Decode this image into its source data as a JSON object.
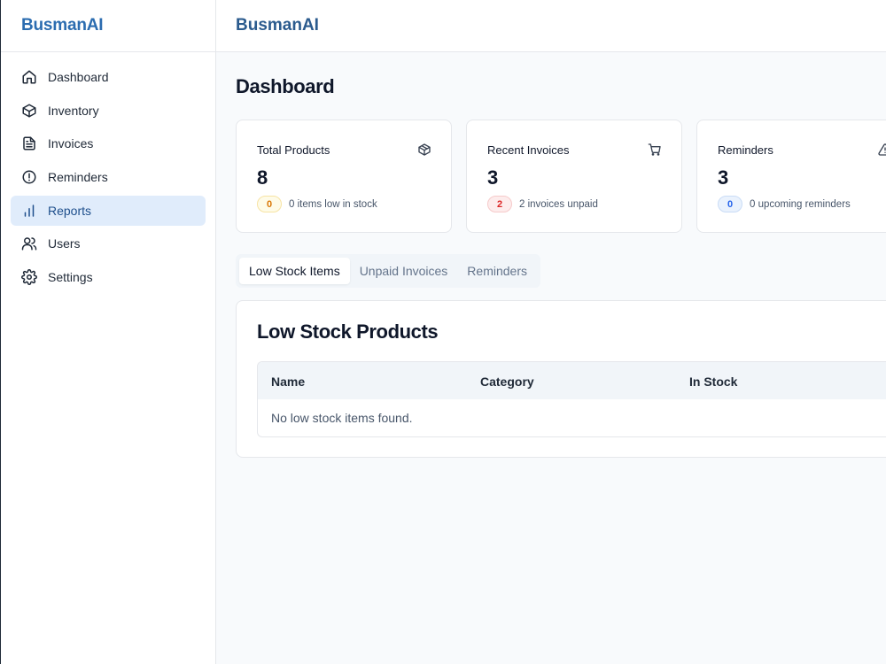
{
  "brand": "BusmanAI",
  "header": {
    "title": "BusmanAI"
  },
  "sidebar": {
    "items": [
      {
        "label": "Dashboard",
        "icon": "home-icon"
      },
      {
        "label": "Inventory",
        "icon": "box-icon"
      },
      {
        "label": "Invoices",
        "icon": "file-text-icon"
      },
      {
        "label": "Reminders",
        "icon": "alert-circle-icon"
      },
      {
        "label": "Reports",
        "icon": "bar-chart-icon",
        "active": true
      },
      {
        "label": "Users",
        "icon": "users-icon"
      },
      {
        "label": "Settings",
        "icon": "gear-icon"
      }
    ]
  },
  "page": {
    "title": "Dashboard"
  },
  "cards": [
    {
      "title": "Total Products",
      "icon": "package-icon",
      "value": "8",
      "badge": "0",
      "badge_color": "#d97706",
      "subtext": "0 items low in stock"
    },
    {
      "title": "Recent Invoices",
      "icon": "cart-icon",
      "value": "3",
      "badge": "2",
      "badge_color": "#dc2626",
      "subtext": "2 invoices unpaid"
    },
    {
      "title": "Reminders",
      "icon": "alert-triangle-icon",
      "value": "3",
      "badge": "0",
      "badge_color": "#2563eb",
      "subtext": "0 upcoming reminders"
    }
  ],
  "tabs": [
    {
      "label": "Low Stock Items",
      "active": true
    },
    {
      "label": "Unpaid Invoices"
    },
    {
      "label": "Reminders"
    }
  ],
  "panel": {
    "title": "Low Stock Products",
    "columns": [
      "Name",
      "Category",
      "In Stock"
    ],
    "empty_message": "No low stock items found."
  },
  "colors": {
    "brand": "#2b6cb0",
    "active_nav_bg": "#e0ecfb",
    "active_nav_text": "#1e4f8c"
  }
}
